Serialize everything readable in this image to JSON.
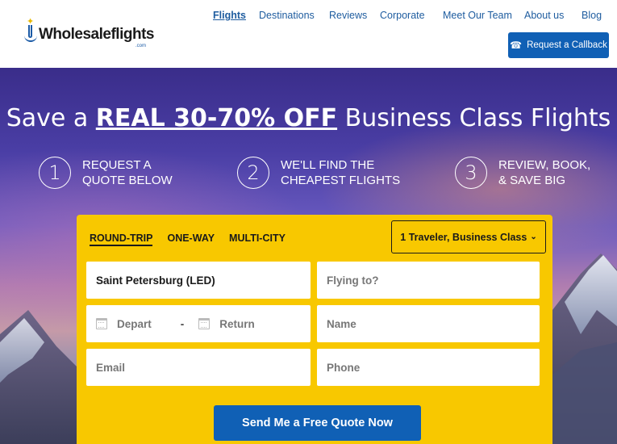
{
  "brand": {
    "logo_text": "Wholesaleflights",
    "logo_sub": ".com"
  },
  "nav": {
    "items": [
      {
        "label": "Flights",
        "active": true
      },
      {
        "label": "Destinations"
      },
      {
        "label": "Reviews"
      },
      {
        "label": "Corporate"
      },
      {
        "label": "Meet Our Team"
      },
      {
        "label": "About us"
      },
      {
        "label": "Blog"
      }
    ],
    "callback_label": "Request a Callback"
  },
  "hero": {
    "title_pre": "Save a ",
    "title_highlight": "REAL 30-70% OFF",
    "title_post": " Business Class Flights",
    "steps": [
      {
        "number": "1",
        "line1": "REQUEST A",
        "line2": "QUOTE BELOW"
      },
      {
        "number": "2",
        "line1": "WE'LL FIND THE",
        "line2": "CHEAPEST FLIGHTS"
      },
      {
        "number": "3",
        "line1": "REVIEW, BOOK,",
        "line2": "& SAVE BIG"
      }
    ]
  },
  "form": {
    "trip_types": [
      "ROUND-TRIP",
      "ONE-WAY",
      "MULTI-CITY"
    ],
    "active_trip_type": "ROUND-TRIP",
    "travelers": "1 Traveler, Business Class",
    "from_value": "Saint Petersburg (LED)",
    "to_placeholder": "Flying to?",
    "depart_placeholder": "Depart",
    "date_separator": "-",
    "return_placeholder": "Return",
    "name_placeholder": "Name",
    "email_placeholder": "Email",
    "phone_placeholder": "Phone",
    "submit_label": "Send Me a Free Quote Now"
  },
  "colors": {
    "accent_blue": "#1060b5",
    "card_yellow": "#f8c800",
    "link_blue": "#1e5c9f"
  }
}
